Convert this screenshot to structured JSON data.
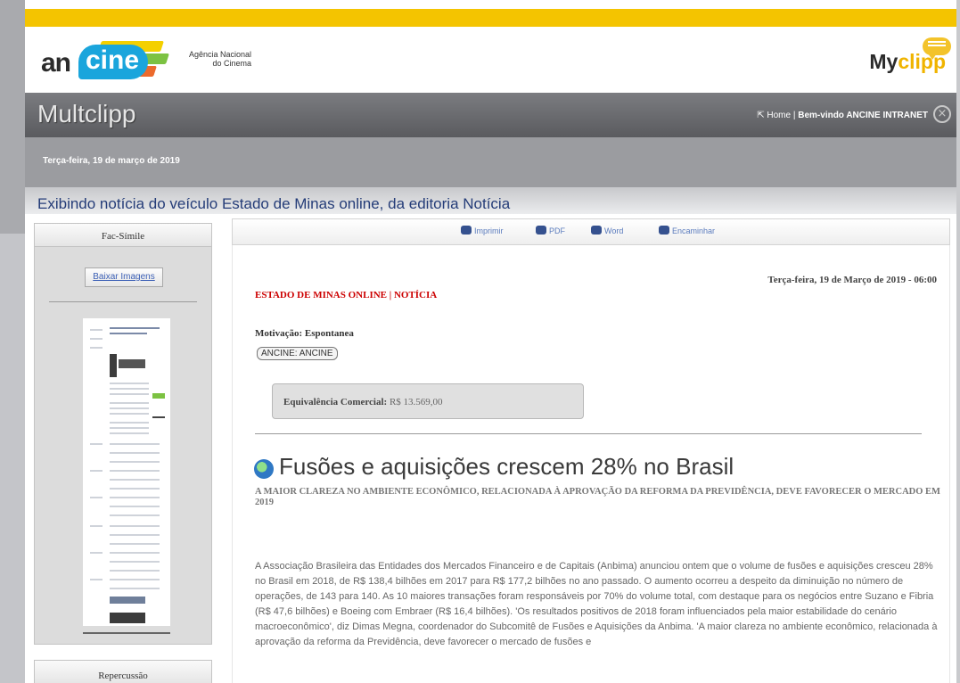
{
  "colors": {
    "accent_yellow": "#f4c400",
    "header_dark": "#5a5b5f",
    "date_bar": "#9b9ca0",
    "title_blue": "#243c78",
    "source_red": "#cc0000",
    "ancine_blue": "#1aa5dc",
    "myclipp_yellow": "#f0b400"
  },
  "header": {
    "logo_prefix": "an",
    "logo_suffix": "cine",
    "tagline_line1": "Agência Nacional",
    "tagline_line2": "do Cinema",
    "myclipp_my": "My",
    "myclipp_clipp": "clipp"
  },
  "topbar": {
    "title": "Multclipp",
    "home_icon": "external-link-icon",
    "home_link": "Home",
    "separator": "|",
    "welcome": "Bem-vindo ANCINE INTRANET",
    "close_icon": "close-circle-icon"
  },
  "date_bar": {
    "date": "Terça-feira, 19 de março de 2019"
  },
  "page": {
    "heading": "Exibindo notícia do veículo Estado de Minas online, da editoria Notícia"
  },
  "sidebar": {
    "fac_simile_title": "Fac-Símile",
    "download_button": "Baixar Imagens",
    "repercussao_title": "Repercussão"
  },
  "toolbar": {
    "items": [
      {
        "label": "Imprimir",
        "icon": "printer-icon"
      },
      {
        "label": "PDF",
        "icon": "pdf-icon"
      },
      {
        "label": "Word",
        "icon": "word-icon"
      },
      {
        "label": "Encaminhar",
        "icon": "forward-icon"
      }
    ]
  },
  "article": {
    "date_time": "Terça-feira, 19 de Março de 2019 - 06:00",
    "source": "ESTADO DE MINAS ONLINE | NOTÍCIA",
    "motivacao": "Motivação: Espontanea",
    "tag": "ANCINE: ANCINE",
    "equivalencia_label": "Equivalência Comercial:",
    "equivalencia_value": "R$ 13.569,00",
    "headline": "Fusões e aquisições crescem 28% no Brasil",
    "subheadline": "A MAIOR CLAREZA NO AMBIENTE ECONÔMICO, RELACIONADA À APROVAÇÃO DA REFORMA DA PREVIDÊNCIA, DEVE FAVORECER O MERCADO EM 2019",
    "body": "A Associação Brasileira das Entidades dos Mercados Financeiro e de Capitais (Anbima) anunciou ontem que o volume de fusões e aquisições cresceu 28% no Brasil em 2018, de R$ 138,4 bilhões em 2017 para R$ 177,2 bilhões no ano passado. O aumento ocorreu a despeito da diminuição no número de operações, de 143 para 140. As 10 maiores transações foram responsáveis por 70% do volume total, com destaque para os negócios entre Suzano e Fibria (R$ 47,6 bilhões) e Boeing com Embraer (R$ 16,4 bilhões). 'Os resultados positivos de 2018 foram influenciados pela maior estabilidade do cenário macroeconômico', diz Dimas Megna, coordenador do Subcomitê de Fusões e Aquisições da Anbima. 'A maior clareza no ambiente econômico, relacionada à aprovação da reforma da Previdência, deve favorecer o mercado de fusões e"
  }
}
